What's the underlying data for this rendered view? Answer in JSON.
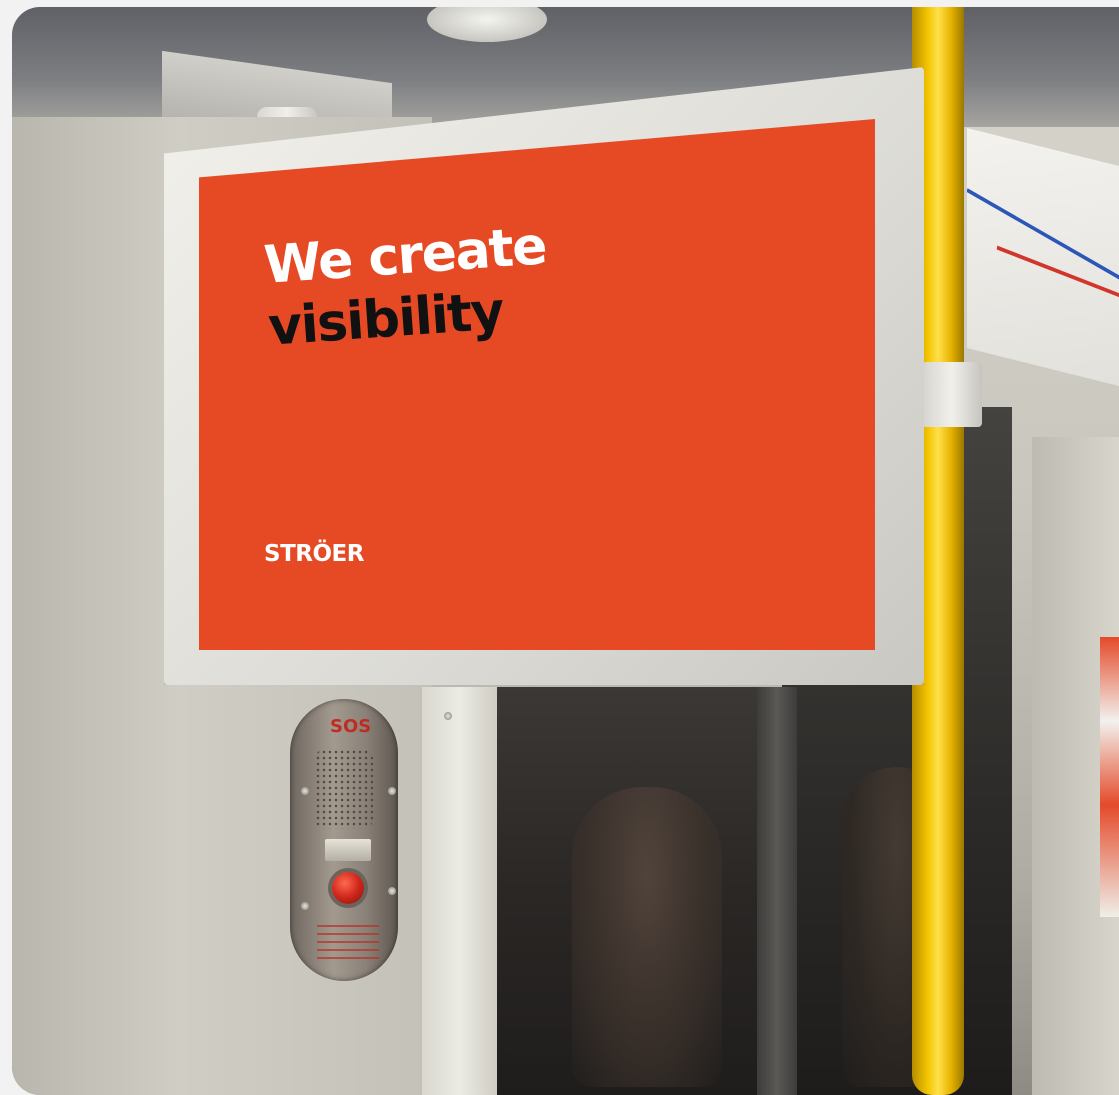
{
  "screen": {
    "headline_line_1": "We create",
    "headline_line_2": "visibility",
    "brand": "STRÖER"
  },
  "intercom": {
    "label": "SOS"
  },
  "colors": {
    "screen_background": "#e64a24",
    "headline_primary": "#ffffff",
    "headline_secondary": "#111111",
    "pole": "#f3c400"
  }
}
